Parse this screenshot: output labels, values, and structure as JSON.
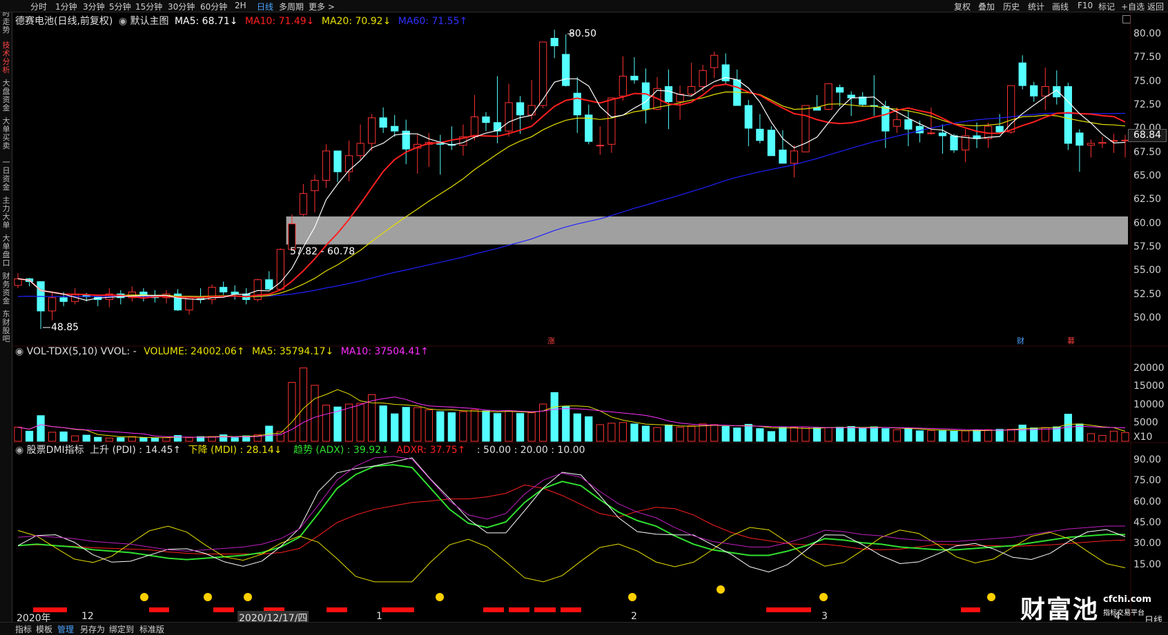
{
  "periods": [
    "分时",
    "1分钟",
    "3分钟",
    "5分钟",
    "15分钟",
    "30分钟",
    "60分钟",
    "2H",
    "日线",
    "多周期",
    "更多 >"
  ],
  "active_period": "日线",
  "right_tools": [
    "复权",
    "叠加",
    "历史",
    "统计",
    "画线",
    "F10",
    "标记",
    "+自选",
    "返回"
  ],
  "left_tabs": [
    "分时走势",
    "技术分析",
    "大盘资金",
    "大单买卖",
    "一日资金",
    "主力大单",
    "大单盘口",
    "财务资金",
    "东财股吧"
  ],
  "main_legend": {
    "title": "德赛电池(日线,前复权)",
    "chart_name": "默认主图",
    "ma5": "MA5: 68.71↓",
    "ma10": "MA10: 71.49↓",
    "ma20": "MA20: 70.92↓",
    "ma60": "MA60: 71.55↑"
  },
  "price_axis": [
    "80.00",
    "77.50",
    "75.00",
    "72.50",
    "70.00",
    "67.50",
    "65.00",
    "62.50",
    "60.00",
    "57.50",
    "55.00",
    "52.50",
    "50.00"
  ],
  "current_price": "68.84",
  "annotations": {
    "high": "80.50",
    "low": "48.85",
    "gap": "57.82 - 60.78",
    "marker_zhang": "涨",
    "marker_cai": "财",
    "marker_zhai": "募"
  },
  "vol_legend": {
    "name": "VOL-TDX(5,10) VVOL: -",
    "volume": "VOLUME: 24002.06↑",
    "ma5": "MA5: 35794.17↓",
    "ma10": "MA10: 37504.41↑"
  },
  "vol_axis": [
    "20000",
    "15000",
    "10000",
    "5000",
    "X10"
  ],
  "dmi_legend": {
    "name": "股票DMI指标",
    "pdi": "上升 (PDI) : 14.45↑",
    "mdi": "下降 (MDI) : 28.14↓",
    "adx": "趋势 (ADX) : 39.92↓",
    "adxr": "ADXR: 37.75↑",
    "levels": ": 50.00 : 20.00 : 10.00"
  },
  "dmi_axis": [
    "90.00",
    "75.00",
    "60.00",
    "45.00",
    "30.00",
    "15.00"
  ],
  "date_axis": [
    "2020年",
    "12",
    "2020/12/17/四",
    "1",
    "2",
    "3",
    "4"
  ],
  "bottom_tabs": [
    "指标",
    "模板",
    "管理",
    "另存为",
    "绑定到",
    "标准版"
  ],
  "active_bottom_tab": "管理",
  "watermark": {
    "brand": "财富池",
    "site": "cfchi.com",
    "slogan": "指标交易平台"
  },
  "mode_label": "日线",
  "zoom_controls": [
    "+",
    "-"
  ],
  "colors": {
    "up": "#ff3232",
    "down": "#54ffff",
    "ma5": "#ffffff",
    "ma10": "#ff2020",
    "ma20": "#e8e000",
    "ma60": "#2020ff",
    "vma10": "#ff30ff",
    "gap": "#a0a0a0",
    "adx": "#30e030"
  },
  "chart_data": {
    "type": "candlestick",
    "candles": [
      [
        53.5,
        54.8,
        53.2,
        54.2
      ],
      [
        54.2,
        54.3,
        53.4,
        53.9
      ],
      [
        53.9,
        53.9,
        48.9,
        50.8
      ],
      [
        50.8,
        52.8,
        49.8,
        52.2
      ],
      [
        52.2,
        52.8,
        51.3,
        51.8
      ],
      [
        51.8,
        53.2,
        51.5,
        52.5
      ],
      [
        52.5,
        52.7,
        51.8,
        52.3
      ],
      [
        52.3,
        52.4,
        51.3,
        52.0
      ],
      [
        52.0,
        53.2,
        51.2,
        52.6
      ],
      [
        52.6,
        53.0,
        51.5,
        52.2
      ],
      [
        52.2,
        53.4,
        51.8,
        52.8
      ],
      [
        52.8,
        53.2,
        51.8,
        52.4
      ],
      [
        52.4,
        53.0,
        51.7,
        52.2
      ],
      [
        52.2,
        53.0,
        51.6,
        52.6
      ],
      [
        52.6,
        53.1,
        50.8,
        50.9
      ],
      [
        50.9,
        52.4,
        50.4,
        52.2
      ],
      [
        52.2,
        53.2,
        51.6,
        52.0
      ],
      [
        52.0,
        53.6,
        51.5,
        53.3
      ],
      [
        53.3,
        53.9,
        52.5,
        52.8
      ],
      [
        52.8,
        53.5,
        52.0,
        52.6
      ],
      [
        52.6,
        53.2,
        51.5,
        52.0
      ],
      [
        52.0,
        54.2,
        51.8,
        54.1
      ],
      [
        54.1,
        55.0,
        53.6,
        53.1
      ],
      [
        53.1,
        57.4,
        53.0,
        57.3
      ],
      [
        57.3,
        61.0,
        57.2,
        60.0
      ],
      [
        61.0,
        64.2,
        60.8,
        63.2
      ],
      [
        63.5,
        65.2,
        61.2,
        64.6
      ],
      [
        64.6,
        68.4,
        63.8,
        67.7
      ],
      [
        67.7,
        67.7,
        64.4,
        65.5
      ],
      [
        65.5,
        68.8,
        64.5,
        67.2
      ],
      [
        67.2,
        70.5,
        66.8,
        68.5
      ],
      [
        68.5,
        71.6,
        67.7,
        71.2
      ],
      [
        71.2,
        72.3,
        69.6,
        70.2
      ],
      [
        70.3,
        71.5,
        69.2,
        69.8
      ],
      [
        69.8,
        71.0,
        66.3,
        67.9
      ],
      [
        68.0,
        69.5,
        65.3,
        68.4
      ],
      [
        68.4,
        69.6,
        66.0,
        68.6
      ],
      [
        68.6,
        69.4,
        65.2,
        68.4
      ],
      [
        68.4,
        70.3,
        67.8,
        68.3
      ],
      [
        68.3,
        70.5,
        67.2,
        69.2
      ],
      [
        69.2,
        73.6,
        68.8,
        71.3
      ],
      [
        71.3,
        71.8,
        69.8,
        70.7
      ],
      [
        70.7,
        75.6,
        68.5,
        69.8
      ],
      [
        69.8,
        74.8,
        69.2,
        72.8
      ],
      [
        72.8,
        73.5,
        69.5,
        71.5
      ],
      [
        71.5,
        75.2,
        71.0,
        72.5
      ],
      [
        72.5,
        79.0,
        72.2,
        79.2
      ],
      [
        79.6,
        80.5,
        77.5,
        78.8
      ],
      [
        77.9,
        80.0,
        74.5,
        74.6
      ],
      [
        73.8,
        75.5,
        69.6,
        71.5
      ],
      [
        71.5,
        72.6,
        68.4,
        68.7
      ],
      [
        68.3,
        70.3,
        67.3,
        68.3
      ],
      [
        68.4,
        73.0,
        67.5,
        73.3
      ],
      [
        73.5,
        77.7,
        73.0,
        75.6
      ],
      [
        75.6,
        77.6,
        74.8,
        75.2
      ],
      [
        74.9,
        76.4,
        70.6,
        72.1
      ],
      [
        72.1,
        75.5,
        72.0,
        74.3
      ],
      [
        74.5,
        76.3,
        70.0,
        72.9
      ],
      [
        72.9,
        74.6,
        71.0,
        73.7
      ],
      [
        73.7,
        77.0,
        73.5,
        74.5
      ],
      [
        74.5,
        76.8,
        74.0,
        76.2
      ],
      [
        76.5,
        78.2,
        75.4,
        77.8
      ],
      [
        76.8,
        78.0,
        74.8,
        75.1
      ],
      [
        75.2,
        76.3,
        72.7,
        72.5
      ],
      [
        72.5,
        73.1,
        68.2,
        70.1
      ],
      [
        70.0,
        71.6,
        68.5,
        68.8
      ],
      [
        69.9,
        70.3,
        67.9,
        67.2
      ],
      [
        67.8,
        69.9,
        67.0,
        66.4
      ],
      [
        66.4,
        68.3,
        64.9,
        67.7
      ],
      [
        67.6,
        70.5,
        67.8,
        72.5
      ],
      [
        72.3,
        73.6,
        72.2,
        72.0
      ],
      [
        72.1,
        74.7,
        72.0,
        74.8
      ],
      [
        74.4,
        74.7,
        72.4,
        73.9
      ],
      [
        73.6,
        74.0,
        71.4,
        73.3
      ],
      [
        73.4,
        73.9,
        72.4,
        72.6
      ],
      [
        72.5,
        75.7,
        71.4,
        72.4
      ],
      [
        72.4,
        73.0,
        68.0,
        69.8
      ],
      [
        70.3,
        72.3,
        69.6,
        71.0
      ],
      [
        71.0,
        72.0,
        68.2,
        70.0
      ],
      [
        70.3,
        70.9,
        68.6,
        69.6
      ],
      [
        69.6,
        72.3,
        69.4,
        69.6
      ],
      [
        69.6,
        70.5,
        67.4,
        69.3
      ],
      [
        69.3,
        69.5,
        67.5,
        67.8
      ],
      [
        67.8,
        70.0,
        66.5,
        69.3
      ],
      [
        69.3,
        70.7,
        68.0,
        69.0
      ],
      [
        69.0,
        70.7,
        68.0,
        70.3
      ],
      [
        70.3,
        71.6,
        69.5,
        69.7
      ],
      [
        69.7,
        73.1,
        69.5,
        74.6
      ],
      [
        77.0,
        77.8,
        74.2,
        74.6
      ],
      [
        74.6,
        75.0,
        72.9,
        73.5
      ],
      [
        73.5,
        76.5,
        72.0,
        74.5
      ],
      [
        74.5,
        76.2,
        72.6,
        73.4
      ],
      [
        74.5,
        74.9,
        67.8,
        68.5
      ],
      [
        69.6,
        70.0,
        65.5,
        68.3
      ],
      [
        68.3,
        68.9,
        67.0,
        68.5
      ],
      [
        68.5,
        69.2,
        68.0,
        68.6
      ],
      [
        68.8,
        69.5,
        67.5,
        68.8
      ],
      [
        68.8,
        69.4,
        67.0,
        68.84
      ]
    ],
    "volume": [
      3900,
      2800,
      7100,
      2500,
      2600,
      1500,
      1700,
      1100,
      900,
      1000,
      1300,
      1000,
      900,
      1000,
      1600,
      1000,
      1300,
      1300,
      1800,
      1000,
      1500,
      1800,
      4200,
      2700,
      16300,
      20300,
      15500,
      10000,
      9500,
      10300,
      10500,
      12900,
      9800,
      7600,
      9400,
      9300,
      8700,
      8200,
      7900,
      8200,
      8700,
      8400,
      7700,
      8400,
      7700,
      7900,
      10300,
      13500,
      9600,
      7600,
      6800,
      4600,
      5000,
      5200,
      4800,
      4200,
      3800,
      4500,
      3900,
      4300,
      4800,
      4600,
      4100,
      3700,
      4700,
      3500,
      2700,
      3800,
      3800,
      3900,
      3700,
      3800,
      3900,
      4100,
      3600,
      4000,
      3500,
      3200,
      3500,
      2900,
      3000,
      2900,
      2800,
      2900,
      3100,
      3200,
      3300,
      3300,
      4500,
      3700,
      3800,
      4000,
      7500,
      4800,
      2100,
      1600,
      2800,
      2400
    ],
    "adx": [
      29,
      30,
      29,
      28,
      26,
      25,
      24,
      22,
      20,
      19,
      20,
      21,
      22,
      24,
      28,
      35,
      52,
      70,
      80,
      86,
      87,
      85,
      70,
      55,
      45,
      42,
      46,
      60,
      70,
      75,
      72,
      62,
      53,
      47,
      43,
      36,
      30,
      26,
      24,
      22,
      22,
      25,
      29,
      34,
      33,
      31,
      30,
      28,
      27,
      26,
      26,
      27,
      28,
      29,
      31,
      33,
      35,
      36,
      37,
      37
    ],
    "series_note": "PDI, MDI, ADX, ADXR",
    "ylim_price": [
      47.5,
      82
    ],
    "ylim_vol": [
      0,
      21000
    ],
    "ylim_dmi": [
      0,
      100
    ]
  }
}
